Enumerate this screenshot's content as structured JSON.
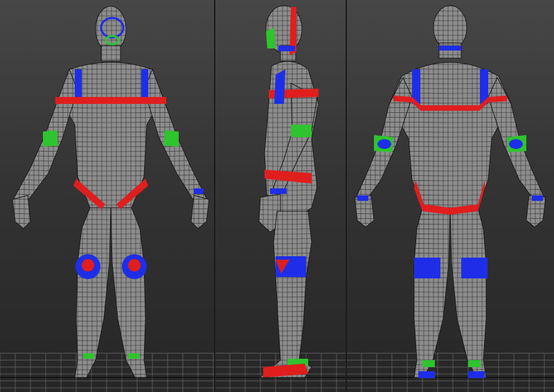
{
  "viewports": [
    {
      "id": "front",
      "view": "front"
    },
    {
      "id": "side",
      "view": "side"
    },
    {
      "id": "back",
      "view": "back"
    }
  ],
  "colors": {
    "background_top": "#474747",
    "background_bottom": "#262626",
    "mesh_fill": "#8d8d8d",
    "wire": "#1a1a1a",
    "loop_red": "#e01e1e",
    "loop_blue": "#1e2ee8",
    "loop_green": "#2ec42e",
    "ground_grid": "#6a6a6a"
  }
}
